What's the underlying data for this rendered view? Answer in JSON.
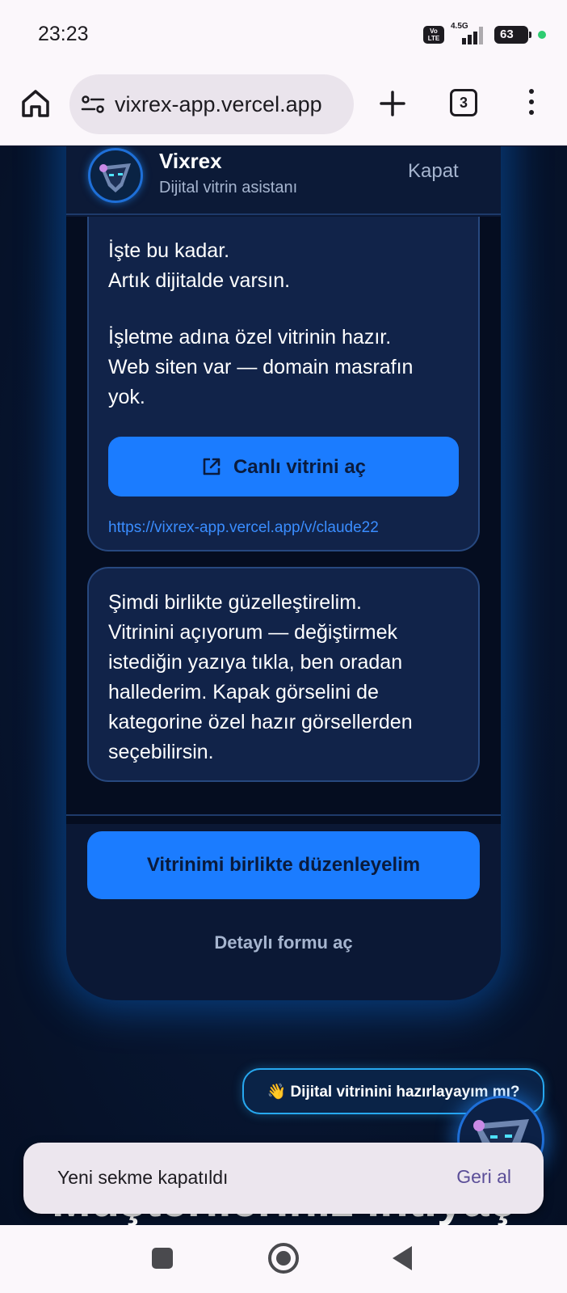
{
  "status_bar": {
    "time": "23:23",
    "volte": "Vo LTE",
    "network": "4.5G",
    "battery": "63"
  },
  "browser": {
    "url": "vixrex-app.vercel.app",
    "tab_count": "3"
  },
  "chat": {
    "header": {
      "name": "Vixrex",
      "subtitle": "Dijital vitrin asistanı",
      "close_label": "Kapat"
    },
    "message_1": {
      "line_1": "İşte bu kadar.",
      "line_2": "Artık dijitalde varsın.",
      "line_3": "İşletme adına özel vitrinin hazır.",
      "line_4": "Web siten var — domain masrafın",
      "line_5": "yok.",
      "button_label": "Canlı vitrini aç",
      "link": "https://vixrex-app.vercel.app/v/claude22"
    },
    "message_2": {
      "line_1": "Şimdi birlikte güzelleştirelim.",
      "line_2": "Vitrinini açıyorum — değiştirmek",
      "line_3": "istediğin yazıya tıkla, ben oradan",
      "line_4": "hallederim. Kapak görselini de",
      "line_5": "kategorine özel hazır görsellerden",
      "line_6": "seçebilirsin."
    },
    "primary_action": "Vitrinimi birlikte düzenleyelim",
    "secondary_action": "Detaylı formu aç"
  },
  "nudge_label": "👋 Dijital vitrinini hazırlayayım mı?",
  "background_headline": "Müşterileriniz ihtiyaç",
  "snackbar": {
    "message": "Yeni sekme kapatıldı",
    "action": "Geri al"
  },
  "colors": {
    "accent": "#1b7cff",
    "page_bg": "#06122b",
    "bubble_bg": "#112349",
    "link": "#3a8dff"
  }
}
